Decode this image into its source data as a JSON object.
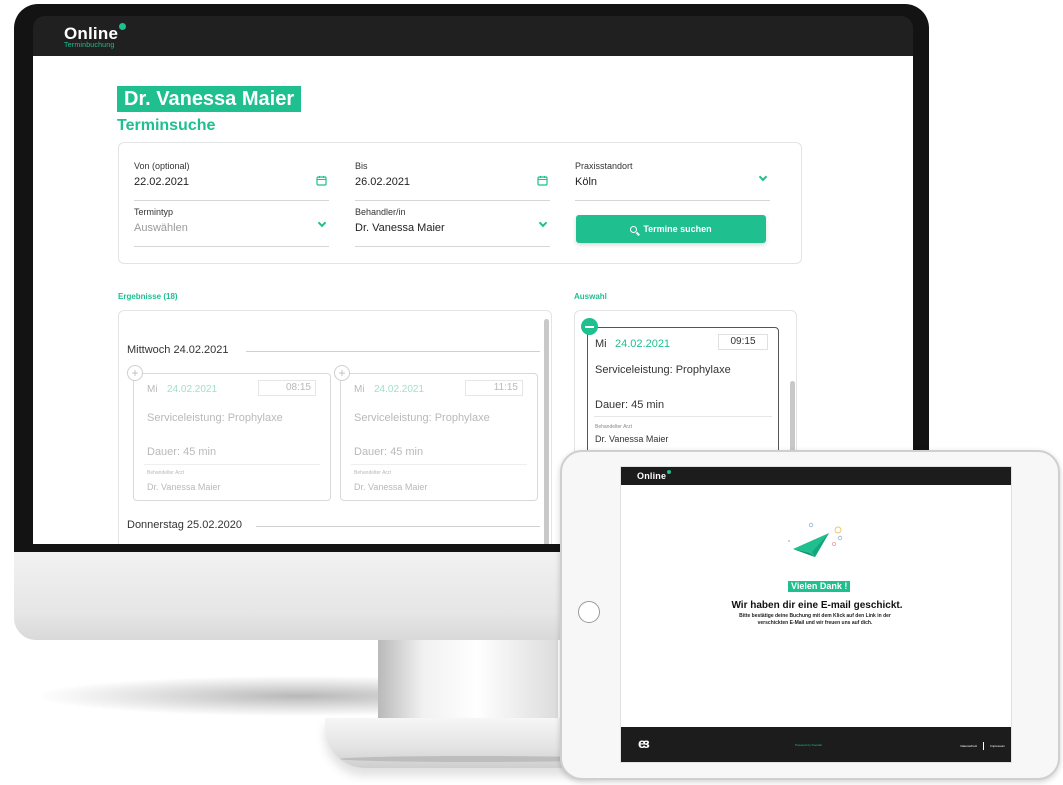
{
  "brand": {
    "name": "Online",
    "tagline": "Terminbuchung",
    "accent_color": "#1fbf8f",
    "dark_color": "#1c1c1c"
  },
  "doctor_banner": "Dr. Vanessa Maier",
  "page_title": "Terminsuche",
  "search_form": {
    "from": {
      "label": "Von (optional)",
      "value": "22.02.2021",
      "icon": "calendar-icon"
    },
    "to": {
      "label": "Bis",
      "value": "26.02.2021",
      "icon": "calendar-icon"
    },
    "location": {
      "label": "Praxisstandort",
      "value": "Köln",
      "icon": "chevron-down-icon"
    },
    "type": {
      "label": "Termintyp",
      "placeholder": "Auswählen",
      "icon": "chevron-down-icon"
    },
    "practitioner": {
      "label": "Behandler/in",
      "value": "Dr. Vanessa Maier",
      "icon": "chevron-down-icon"
    },
    "search_button": {
      "label": "Termine suchen",
      "icon": "search-icon"
    }
  },
  "results": {
    "heading": "Ergebnisse (18)",
    "days": [
      {
        "label": "Mittwoch 24.02.2021",
        "slots": [
          {
            "weekday": "Mi",
            "date": "24.02.2021",
            "time": "08:15",
            "service": "Serviceleistung: Prophylaxe",
            "duration": "Dauer: 45 min",
            "doctor_label": "Behandelter Arzt",
            "doctor": "Dr. Vanessa Maier"
          },
          {
            "weekday": "Mi",
            "date": "24.02.2021",
            "time": "11:15",
            "service": "Serviceleistung: Prophylaxe",
            "duration": "Dauer: 45 min",
            "doctor_label": "Behandelter Arzt",
            "doctor": "Dr. Vanessa Maier"
          }
        ]
      },
      {
        "label": "Donnerstag 25.02.2020",
        "slots": []
      }
    ]
  },
  "selection": {
    "heading": "Auswahl",
    "slot": {
      "weekday": "Mi",
      "date": "24.02.2021",
      "time": "09:15",
      "service": "Serviceleistung: Prophylaxe",
      "duration": "Dauer: 45 min",
      "doctor_label": "Behandelter Arzt",
      "doctor": "Dr. Vanessa Maier"
    }
  },
  "tablet": {
    "logo": "Online",
    "thanks": "Vielen Dank !",
    "title": "Wir haben dir eine E-mail geschickt.",
    "body": "Bitte bestätige deine Buchung mit dem Klick auf den Link in der verschickten E-Mail und wir freuen uns auf dich.",
    "footer_logo": "eз",
    "powered": "Powered by Doodelr",
    "link_privacy": "Datenschutz",
    "link_imprint": "Impressum"
  }
}
